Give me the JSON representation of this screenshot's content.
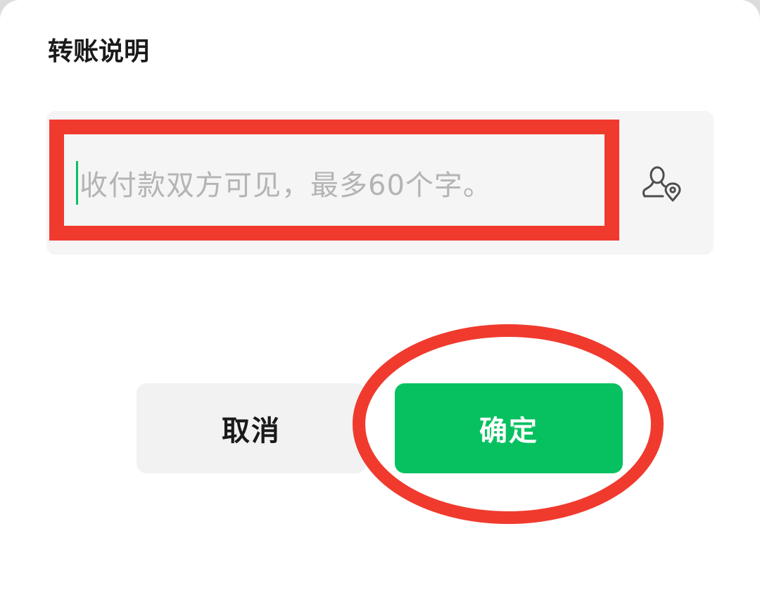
{
  "dialog": {
    "title": "转账说明",
    "note_field": {
      "placeholder": "收付款双方可见，最多60个字。",
      "value": ""
    },
    "contact_icon": "contact-location-icon",
    "cancel_label": "取消",
    "confirm_label": "确定"
  },
  "colors": {
    "accent": "#07c160",
    "annotation": "#f03a2e"
  }
}
